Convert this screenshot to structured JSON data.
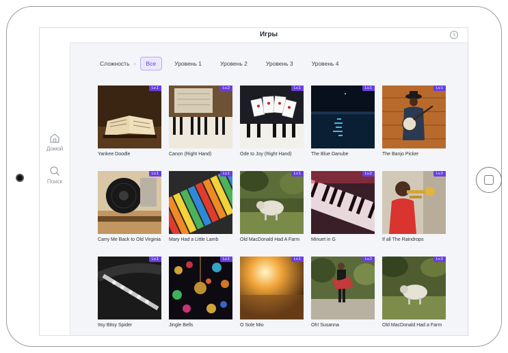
{
  "app": {
    "title": "Игры"
  },
  "sidebar": {
    "items": [
      {
        "label": "Домой",
        "icon": "home-icon"
      },
      {
        "label": "Поиск",
        "icon": "search-icon"
      }
    ]
  },
  "filters": {
    "label": "Сложность",
    "options": [
      "Все",
      "Уровень 1",
      "Уровень 2",
      "Уровень 3",
      "Уровень 4"
    ],
    "selected": "Все"
  },
  "accent_color": "#6a3fe0",
  "cards": [
    {
      "title": "Yankee Doodle",
      "level": "Lv.1"
    },
    {
      "title": "Canon (Right Hand)",
      "level": "Lv.2"
    },
    {
      "title": "Ode to Joy (Right Hand)",
      "level": "Lv.1"
    },
    {
      "title": "The Blue Danube",
      "level": "Lv.1"
    },
    {
      "title": "The Banjo Picker",
      "level": "Lv.1"
    },
    {
      "title": "Carry Me Back to Old Virginia",
      "level": "Lv.1"
    },
    {
      "title": "Mary Had a Little Lamb",
      "level": "Lv.1"
    },
    {
      "title": "Old MacDonald Had A Farm",
      "level": "Lv.1"
    },
    {
      "title": "Minuet in G",
      "level": "Lv.2"
    },
    {
      "title": "If all The Raindrops",
      "level": "Lv.2"
    },
    {
      "title": "Itsy Bitsy Spider",
      "level": "Lv.1"
    },
    {
      "title": "Jingle Bells",
      "level": "Lv.1"
    },
    {
      "title": "O Sole Mio",
      "level": "Lv.1"
    },
    {
      "title": "Oh! Susanna",
      "level": "Lv.2"
    },
    {
      "title": "Old MacDonald Had a Farm",
      "level": "Lv.2"
    }
  ]
}
